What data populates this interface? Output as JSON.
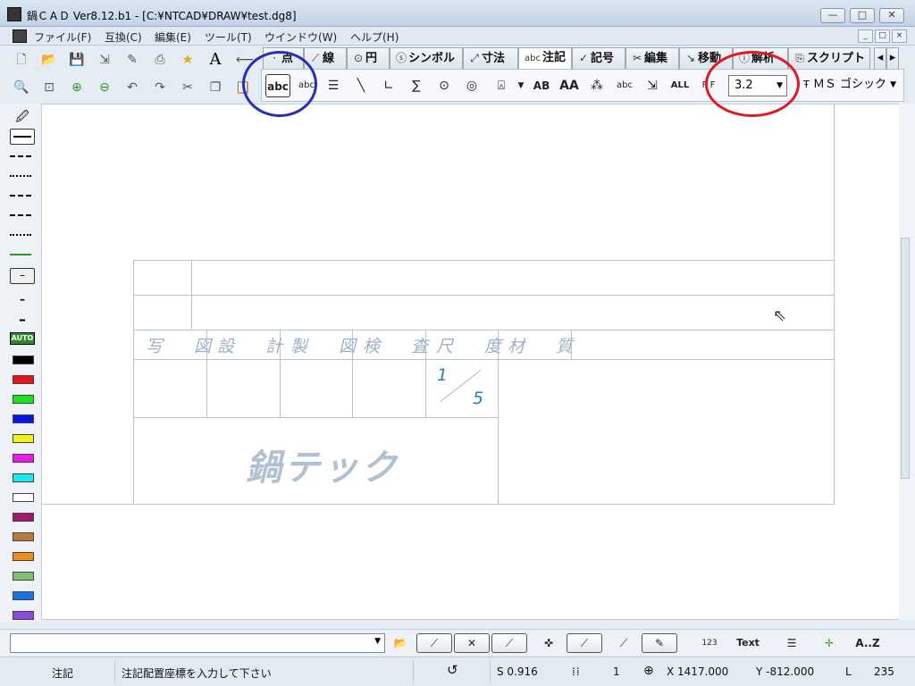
{
  "window": {
    "title": "鍋ＣＡＤ Ver8.12.b1 - [C:¥NTCAD¥DRAW¥test.dg8]",
    "controls": [
      "—",
      "□",
      "✕"
    ]
  },
  "menu": {
    "items": [
      "ファイル(F)",
      "互換(C)",
      "編集(E)",
      "ツール(T)",
      "ウインドウ(W)",
      "ヘルプ(H)"
    ],
    "mdi_controls": [
      "_",
      "□",
      "×"
    ]
  },
  "tabs": [
    {
      "label": "点",
      "icon": "·"
    },
    {
      "label": "線",
      "icon": "⟋"
    },
    {
      "label": "円",
      "icon": "⊙"
    },
    {
      "label": "シンボル",
      "icon": "ⓢ"
    },
    {
      "label": "寸法",
      "icon": "⤢"
    },
    {
      "label": "注記",
      "icon": "abc",
      "active": true
    },
    {
      "label": "記号",
      "icon": "✓"
    },
    {
      "label": "編集",
      "icon": "✂"
    },
    {
      "label": "移動",
      "icon": "↘"
    },
    {
      "label": "解析",
      "icon": "ⓘ"
    },
    {
      "label": "スクリプト",
      "icon": "⎘"
    }
  ],
  "text_toolbar": {
    "height_value": "3.2",
    "font_value": "ＭＳ ゴシック",
    "selected_tool": "abc"
  },
  "title_block": {
    "headers": [
      "写　図",
      "設　計",
      "製　図",
      "検　査",
      "尺　度",
      "材　質"
    ],
    "scale_top": "1",
    "scale_bottom": "5",
    "company": "鍋テック"
  },
  "palette": {
    "auto_label": "AUTO",
    "colors": [
      "#000000",
      "#e8141c",
      "#17e51d",
      "#0a14e6",
      "#f2f217",
      "#ef17ef",
      "#17eaf0",
      "#ffffff",
      "#a2166c",
      "#b77b3c",
      "#f28a1c",
      "#7fbf74",
      "#1b72e8",
      "#8d48e8"
    ]
  },
  "bottom_toolbar": {
    "command_value": "",
    "text_label": "Text",
    "sort_label": "A..Z"
  },
  "status": {
    "mode": "注記",
    "message": "注記配置座標を入力して下さい",
    "scale": "S 0.916",
    "layer": "1",
    "x": "X 1417.000",
    "y": "Y -812.000",
    "length_label": "L",
    "length_value": "235"
  }
}
